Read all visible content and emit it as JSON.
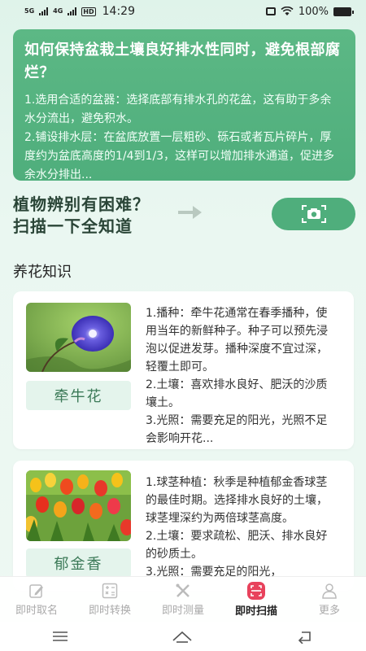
{
  "status_bar": {
    "network_1": "5G",
    "network_2": "4G",
    "hd": "HD",
    "time": "14:29",
    "battery_text": "100%",
    "battery_level": 1.0
  },
  "faq_card": {
    "title": "如何保持盆栽土壤良好排水性同时，避免根部腐烂？",
    "lines": [
      "1.选用合适的盆器：选择底部有排水孔的花盆，这有助于多余水分流出，避免积水。",
      "2.铺设排水层：在盆底放置一层粗砂、砾石或者瓦片碎片，厚度约为盆底高度的1/4到1/3，这样可以增加排水通道，促进多余水分排出..."
    ]
  },
  "scan_banner": {
    "line1": "植物辨别有困难？",
    "line2": "扫描一下全知道",
    "button_icon": "camera-scan-icon"
  },
  "section": {
    "title": "养花知识"
  },
  "plants": [
    {
      "name": "牵牛花",
      "image": "morning-glory-photo",
      "lines": [
        "1.播种：牵牛花通常在春季播种，使用当年的新鲜种子。种子可以预先浸泡以促进发芽。播种深度不宜过深，轻覆土即可。",
        "2.土壤：喜欢排水良好、肥沃的沙质壤土。",
        "3.光照：需要充足的阳光，光照不足会影响开花..."
      ]
    },
    {
      "name": "郁金香",
      "image": "tulip-field-photo",
      "lines": [
        "1.球茎种植：秋季是种植郁金香球茎的最佳时期。选择排水良好的土壤，球茎埋深约为两倍球茎高度。",
        "2.土壤：要求疏松、肥沃、排水良好的砂质土。",
        "3.光照：需要充足的阳光，"
      ]
    }
  ],
  "bottom_nav": [
    {
      "label": "即时取名",
      "icon": "pen-icon",
      "active": false
    },
    {
      "label": "即时转换",
      "icon": "calculator-icon",
      "active": false
    },
    {
      "label": "即时测量",
      "icon": "ruler-cross-icon",
      "active": false
    },
    {
      "label": "即时扫描",
      "icon": "scan-icon",
      "active": true
    },
    {
      "label": "更多",
      "icon": "user-icon",
      "active": false
    }
  ],
  "colors": {
    "accent": "#4fae7c",
    "active_nav": "#e8425c"
  }
}
